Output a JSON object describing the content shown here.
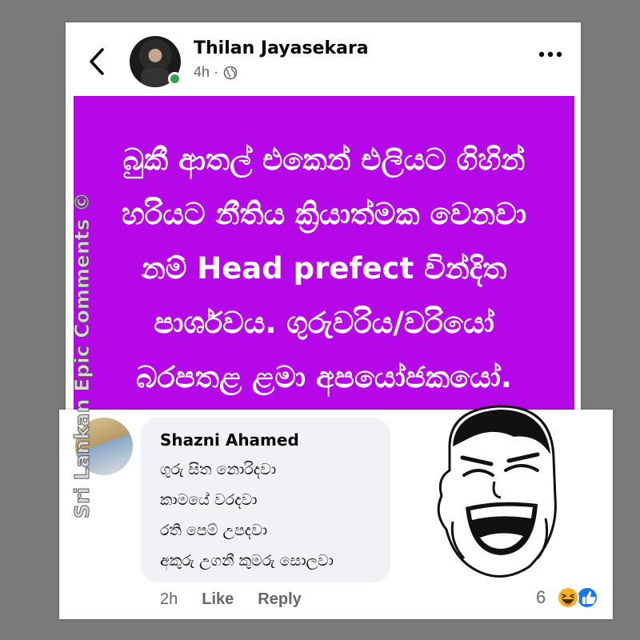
{
  "post": {
    "author": "Thilan Jayasekara",
    "time": "4h ·",
    "banner_lines": [
      "බුකී ආතල් එකෙන් එලියට ගිහින්",
      "හරියට නීතිය ක්‍රියාත්මක වෙනවා",
      "නම් Head prefect වින්දිත",
      "පාර්ශවය. ගුරුවරිය/වරියෝ",
      "බරපතළ ළමා අපයෝජකයෝ."
    ],
    "banner_color": "#b507e8"
  },
  "watermark": "Sri Lankan Epic Comments ©",
  "comment": {
    "author": "Shazni Ahamed",
    "lines": [
      "ගුරු සිත නොරිදවා",
      "කාමයේ වරදවා",
      "රති පෙම් උපදවා",
      "අකුරු උගනී කුමරු සොලවා"
    ],
    "time": "2h",
    "like_label": "Like",
    "reply_label": "Reply",
    "reaction_count": "6"
  },
  "icons": {
    "back": "chevron-left-icon",
    "more": "more-icon",
    "privacy": "globe-icon",
    "reactions": [
      "haha-icon",
      "like-icon"
    ]
  },
  "colors": {
    "online": "#31a24c",
    "like_blue": "#1877f2",
    "haha_yellow": "#f7b125"
  }
}
